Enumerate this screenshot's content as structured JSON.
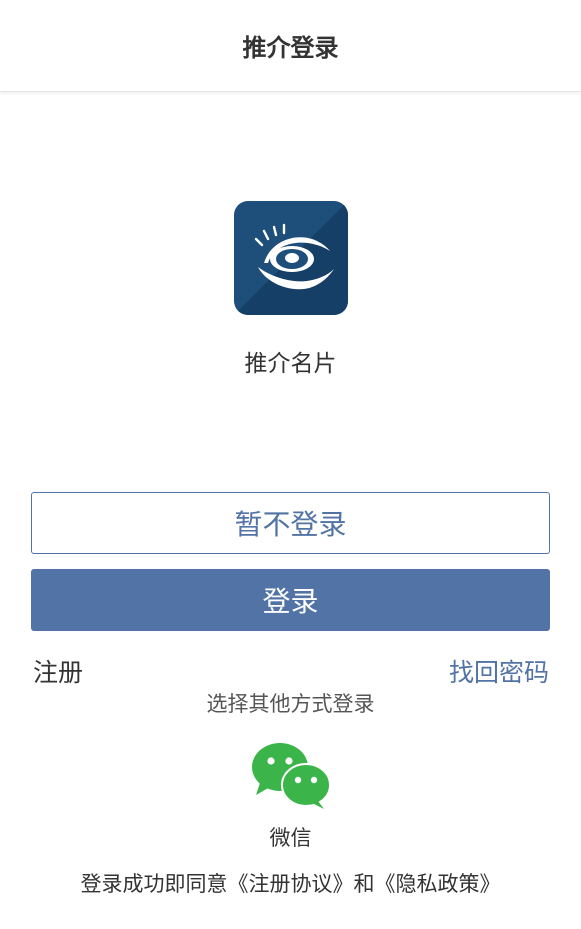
{
  "header": {
    "title": "推介登录"
  },
  "app": {
    "name": "推介名片",
    "logo_icon": "eye-logo-icon"
  },
  "buttons": {
    "skip_label": "暂不登录",
    "login_label": "登录"
  },
  "links": {
    "register": "注册",
    "forgot_password": "找回密码"
  },
  "other_login": {
    "label": "选择其他方式登录",
    "wechat_label": "微信",
    "wechat_icon": "wechat-icon"
  },
  "agreement": {
    "text": "登录成功即同意《注册协议》和《隐私政策》"
  },
  "colors": {
    "accent": "#5273a5",
    "logo_bg": "#1d4f7c",
    "wechat": "#3bb54a"
  }
}
